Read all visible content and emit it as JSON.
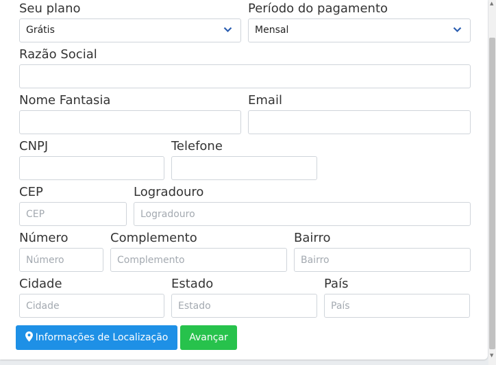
{
  "form": {
    "plano": {
      "label": "Seu plano",
      "value": "Grátis"
    },
    "periodo": {
      "label": "Período do pagamento",
      "value": "Mensal"
    },
    "razao_social": {
      "label": "Razão Social",
      "value": "",
      "placeholder": ""
    },
    "nome_fantasia": {
      "label": "Nome Fantasia",
      "value": "",
      "placeholder": ""
    },
    "email": {
      "label": "Email",
      "value": "",
      "placeholder": ""
    },
    "cnpj": {
      "label": "CNPJ",
      "value": "",
      "placeholder": ""
    },
    "telefone": {
      "label": "Telefone",
      "value": "",
      "placeholder": ""
    },
    "cep": {
      "label": "CEP",
      "value": "",
      "placeholder": "CEP"
    },
    "logradouro": {
      "label": "Logradouro",
      "value": "",
      "placeholder": "Logradouro"
    },
    "numero": {
      "label": "Número",
      "value": "",
      "placeholder": "Número"
    },
    "complemento": {
      "label": "Complemento",
      "value": "",
      "placeholder": "Complemento"
    },
    "bairro": {
      "label": "Bairro",
      "value": "",
      "placeholder": "Bairro"
    },
    "cidade": {
      "label": "Cidade",
      "value": "",
      "placeholder": "Cidade"
    },
    "estado": {
      "label": "Estado",
      "value": "",
      "placeholder": "Estado"
    },
    "pais": {
      "label": "País",
      "value": "",
      "placeholder": "País"
    }
  },
  "buttons": {
    "localizacao": {
      "label": "Informações de Localização",
      "icon": "map-marker-icon",
      "color": "#1e90e6"
    },
    "avancar": {
      "label": "Avançar",
      "color": "#27c24c"
    }
  },
  "colors": {
    "accent_blue": "#1e90e6",
    "success_green": "#27c24c",
    "chevron": "#2a5db0"
  }
}
